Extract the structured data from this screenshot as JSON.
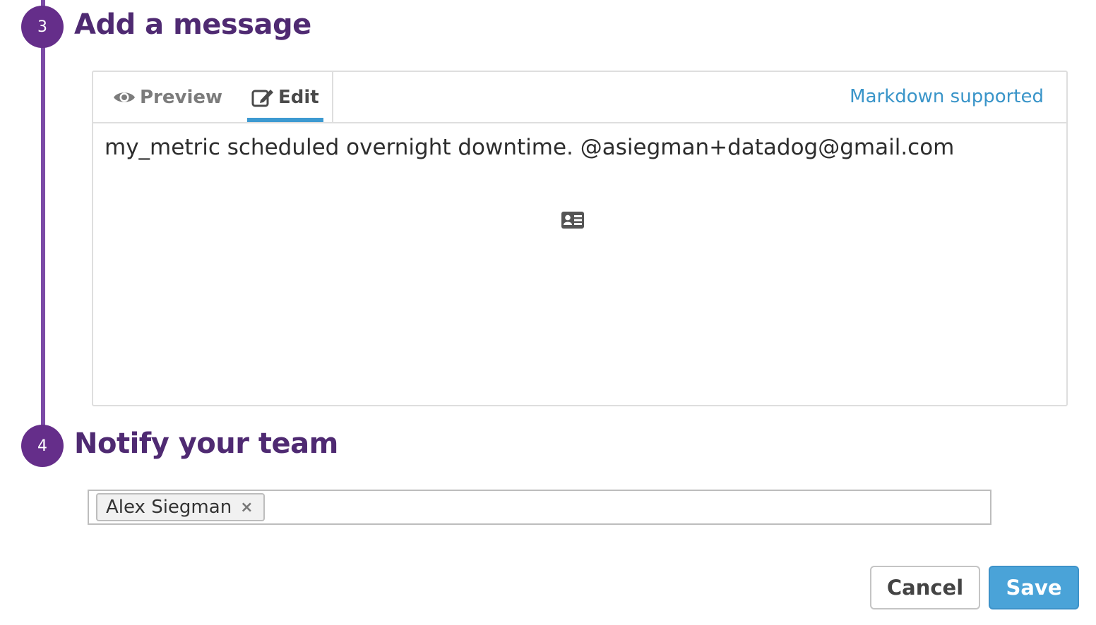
{
  "steps": [
    {
      "number": "3",
      "title": "Add a message"
    },
    {
      "number": "4",
      "title": "Notify your team"
    }
  ],
  "editor": {
    "tabs": [
      {
        "label": "Preview",
        "icon": "eye-icon",
        "active": false
      },
      {
        "label": "Edit",
        "icon": "edit-icon",
        "active": true
      }
    ],
    "markdown_label": "Markdown supported",
    "message": "my_metric scheduled overnight downtime. @asiegman+datadog@gmail.com",
    "body_icon": "contact-card-icon"
  },
  "notify": {
    "recipients": [
      {
        "name": "Alex Siegman",
        "remove_symbol": "×"
      }
    ]
  },
  "actions": {
    "cancel_label": "Cancel",
    "save_label": "Save"
  },
  "colors": {
    "step_purple": "#652e8a",
    "title_purple": "#4f2a72",
    "accent_blue": "#3d9ad1",
    "save_blue": "#4aa3d8"
  }
}
